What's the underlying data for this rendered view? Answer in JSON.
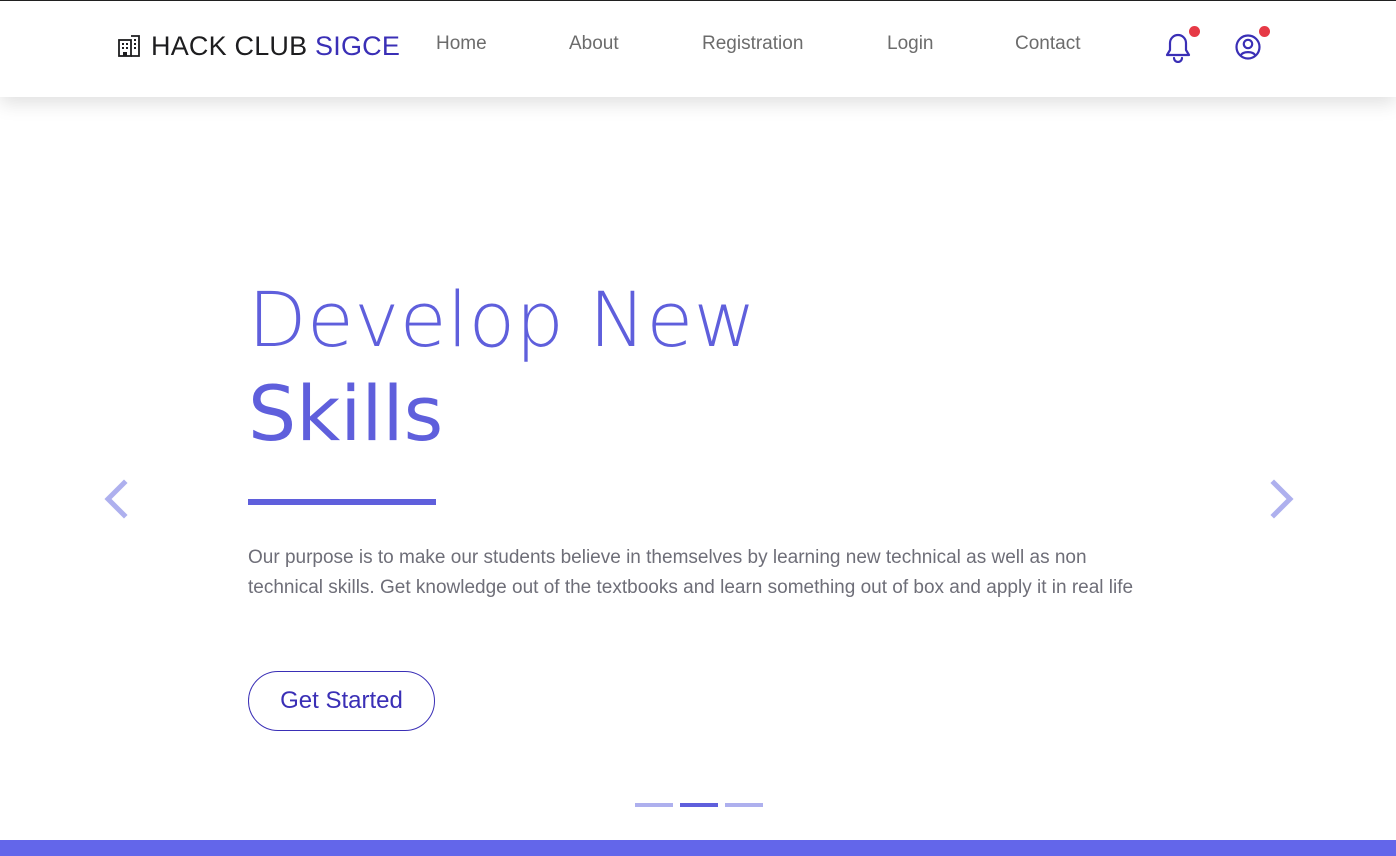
{
  "brand": {
    "icon": "building-icon",
    "name_primary": "HACK CLUB",
    "name_accent": "SIGCE",
    "accent_color": "#3a2fb6"
  },
  "nav": {
    "links": [
      {
        "label": "Home"
      },
      {
        "label": "About"
      },
      {
        "label": "Registration"
      },
      {
        "label": "Login"
      },
      {
        "label": "Contact"
      }
    ],
    "icons": [
      {
        "name": "bell-icon",
        "badge": true
      },
      {
        "name": "user-circle-icon",
        "badge": true
      }
    ],
    "badge_color": "#e63946"
  },
  "hero": {
    "title_line1": "Develop New",
    "title_line2": "Skills",
    "description": "Our purpose is to make our students believe in themselves by learning new technical as well as non technical skills. Get knowledge out of the textbooks and learn something out of box and apply it in real life",
    "cta_label": "Get Started",
    "title_color": "#5f5fdc"
  },
  "carousel": {
    "prev_icon": "chevron-left-icon",
    "next_icon": "chevron-right-icon",
    "slide_count": 3,
    "active_index": 1
  },
  "footer_bar_color": "#6366ea"
}
